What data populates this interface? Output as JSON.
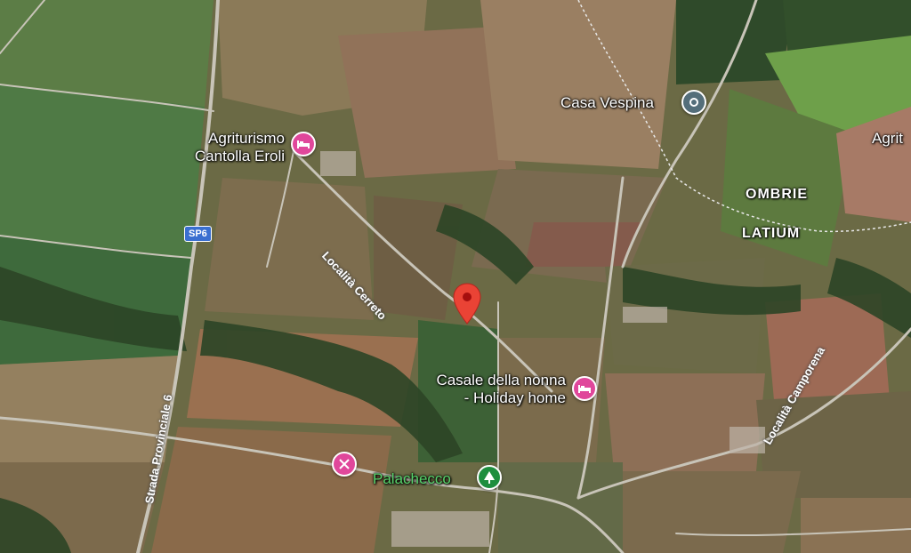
{
  "map": {
    "labels": {
      "agriturismo_cantolla": [
        "Agriturismo",
        "Cantolla Eroli"
      ],
      "casa_vespina": "Casa Vespina",
      "agrit_partial": "Agrit",
      "ombrie": "OMBRIE",
      "latium": "LATIUM",
      "casale": [
        "Casale della nonna",
        "- Holiday home"
      ],
      "palachecco": "Palachecco",
      "localita_cerreto": "Località Cerreto",
      "localita_camporena": "Località Camporena",
      "strada_provinciale": "Strada Provinciale 6",
      "sp6_shield": "SP6"
    },
    "icons": {
      "hotel": "bed-icon",
      "landmark": "location-icon",
      "pin": "red-map-pin-icon",
      "park": "tree-icon",
      "tools": "hammer-wrench-icon"
    },
    "colors": {
      "hotel_pin": "#e0479b",
      "landmark_pin": "#546e7a",
      "park_pin": "#1e8e3e",
      "location_pin": "#ea4335",
      "shield": "#3a6fd0",
      "park_text": "#57d36b"
    }
  }
}
